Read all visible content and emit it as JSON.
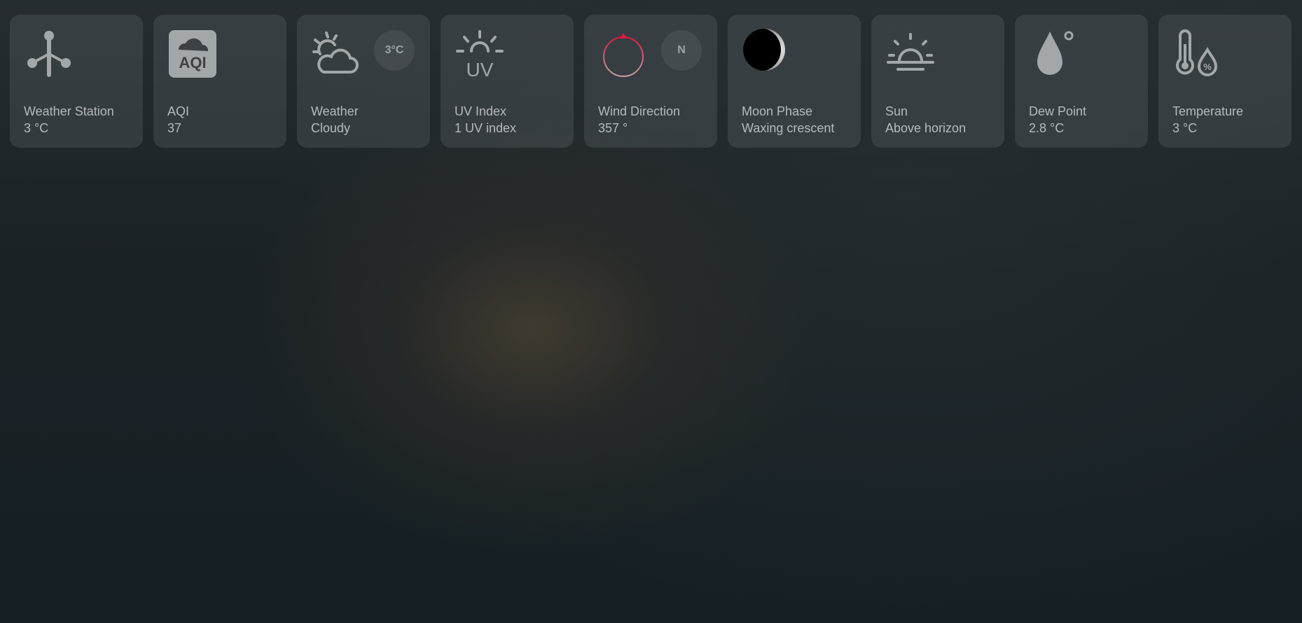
{
  "tiles": [
    {
      "name": "Weather Station",
      "state": "3 °C",
      "icon": "weather-station-icon"
    },
    {
      "name": "AQI",
      "state": "37",
      "icon": "aqi-icon"
    },
    {
      "name": "Weather",
      "state": "Cloudy",
      "icon": "partly-cloudy-icon",
      "badge": "3°C"
    },
    {
      "name": "UV Index",
      "state": "1 UV index",
      "icon": "uv-icon"
    },
    {
      "name": "Wind Direction",
      "state": "357 °",
      "icon": "compass-icon",
      "badge": "N"
    },
    {
      "name": "Moon Phase",
      "state": "Waxing crescent",
      "icon": "moon-icon"
    },
    {
      "name": "Sun",
      "state": "Above horizon",
      "icon": "sunrise-icon"
    },
    {
      "name": "Dew Point",
      "state": "2.8 °C",
      "icon": "droplet-icon"
    },
    {
      "name": "Temperature",
      "state": "3 °C",
      "icon": "thermometer-humidity-icon"
    }
  ],
  "colors": {
    "icon": "#a3a7aa",
    "compass_accent": "#e0173f",
    "moon": "#000000"
  }
}
